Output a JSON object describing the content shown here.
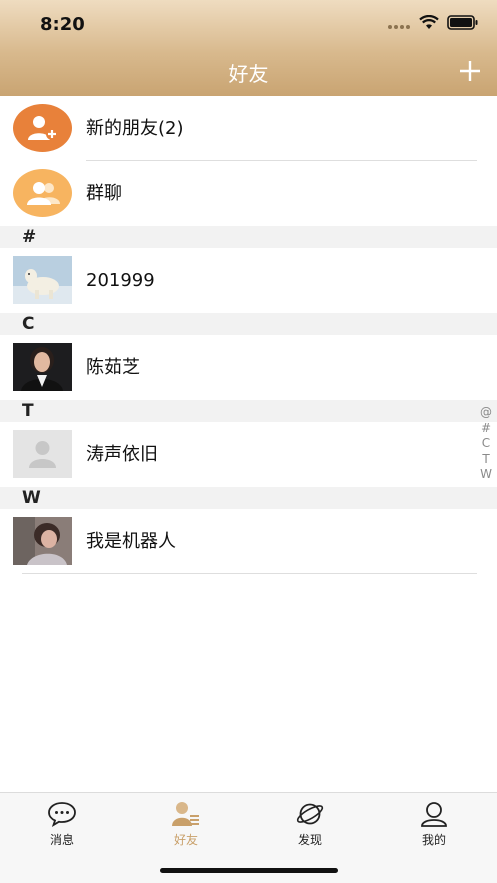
{
  "status_bar": {
    "time": "8:20",
    "signal_icon": "signal-dots-icon",
    "wifi_icon": "wifi-icon",
    "battery_icon": "battery-icon"
  },
  "header": {
    "title": "好友",
    "add_icon": "plus-icon"
  },
  "special_rows": [
    {
      "label": "新的朋友(2)",
      "icon": "add-user-icon",
      "color": "#e8813a"
    },
    {
      "label": "群聊",
      "icon": "group-icon",
      "color": "#f7b460"
    }
  ],
  "sections": [
    {
      "letter": "#",
      "contacts": [
        {
          "name": "201999",
          "avatar": "polar-bear-photo"
        }
      ]
    },
    {
      "letter": "C",
      "contacts": [
        {
          "name": "陈茹芝",
          "avatar": "woman-portrait-photo"
        }
      ]
    },
    {
      "letter": "T",
      "contacts": [
        {
          "name": "涛声依旧",
          "avatar": "default-avatar-icon"
        }
      ]
    },
    {
      "letter": "W",
      "contacts": [
        {
          "name": "我是机器人",
          "avatar": "woman-photo"
        }
      ]
    }
  ],
  "index_bar": [
    "@",
    "#",
    "C",
    "T",
    "W"
  ],
  "tabbar": {
    "active_color": "#c9a06a",
    "tabs": [
      {
        "label": "消息",
        "icon": "chat-bubble-icon",
        "active": false
      },
      {
        "label": "好友",
        "icon": "contacts-icon",
        "active": true
      },
      {
        "label": "发现",
        "icon": "planet-icon",
        "active": false
      },
      {
        "label": "我的",
        "icon": "profile-icon",
        "active": false
      }
    ]
  }
}
